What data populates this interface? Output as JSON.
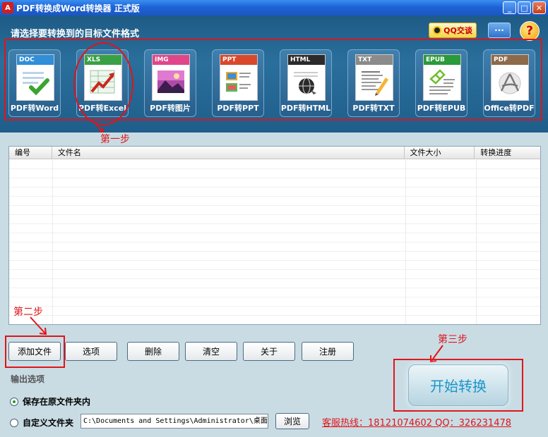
{
  "window": {
    "title": "PDF转换成Word转换器 正式版",
    "app_icon": "pdf-app-icon"
  },
  "header": {
    "title": "请选择要转换到的目标文件格式",
    "qq_button": "QQ交谈",
    "menu_button": "···",
    "help_button": "?"
  },
  "formats": [
    {
      "tag": "DOC",
      "label": "PDF转Word",
      "color": "#2f8fd8"
    },
    {
      "tag": "XLS",
      "label": "PDF转Excel",
      "color": "#3aa045"
    },
    {
      "tag": "IMG",
      "label": "PDF转图片",
      "color": "#e0468a"
    },
    {
      "tag": "PPT",
      "label": "PDF转PPT",
      "color": "#d9482b"
    },
    {
      "tag": "HTML",
      "label": "PDF转HTML",
      "color": "#2b2b2b"
    },
    {
      "tag": "TXT",
      "label": "PDF转TXT",
      "color": "#8b8b8b"
    },
    {
      "tag": "EPUB",
      "label": "PDF转EPUB",
      "color": "#2a9a3a"
    },
    {
      "tag": "PDF",
      "label": "Office转PDF",
      "color": "#8d6a4a"
    }
  ],
  "steps": {
    "one": "第一步",
    "two": "第二步",
    "three": "第三步"
  },
  "table": {
    "columns": [
      "编号",
      "文件名",
      "文件大小",
      "转换进度"
    ],
    "rows": []
  },
  "buttons": {
    "add": "添加文件",
    "options": "选项",
    "delete": "删除",
    "clear": "清空",
    "about": "关于",
    "register": "注册"
  },
  "output": {
    "title": "输出选项",
    "option_original": "保存在原文件夹内",
    "option_custom": "自定义文件夹",
    "selected": "保存在原文件夹内",
    "path": "C:\\Documents and Settings\\Administrator\\桌面",
    "browse": "浏览"
  },
  "hotline": "客服热线：18121074602 QQ：326231478",
  "start_button": "开始转换",
  "colors": {
    "accent_red": "#e0141a",
    "header_blue": "#2a6f9c",
    "start_text": "#1a95c9"
  }
}
